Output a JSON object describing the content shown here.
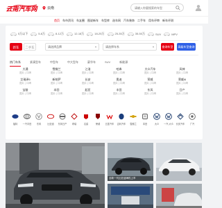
{
  "brand": {
    "logo_text": "云南汽车网",
    "accent": "#e60012"
  },
  "header": {
    "city": "云南",
    "search": {
      "placeholder": "请输入你要搜索的车型"
    }
  },
  "nav": {
    "items": [
      "首页",
      "车市资讯",
      "车友圈",
      "图说新车",
      "车型库",
      "选车网",
      "汽车装饰",
      "二手车",
      "用车评审",
      "新车评测",
      "维权平台",
      "保险评审"
    ]
  },
  "finder": {
    "price_ranges": [
      "5万以下",
      "5-8万",
      "8-12万",
      "12-18万",
      "18-25万",
      "25-35万",
      "35-50万",
      "50万以上",
      "SUV",
      "MPV",
      "跑车"
    ],
    "mode_new": "新车",
    "mode_used": "二手车",
    "brand_select": "请选择品牌",
    "series_select": "请选择车系",
    "query_button": "查询车型",
    "advanced_button": "高级车型查询"
  },
  "tabs": [
    "热门车系",
    "紧凑型车",
    "中型车",
    "中大型车",
    "豪华车",
    "SUV",
    "新能源"
  ],
  "brand_grid": [
    {
      "name": "大通",
      "subs": "图片 | 口碑"
    },
    {
      "name": "雪佛兰",
      "subs": "图片 | 口碑"
    },
    {
      "name": "江淮",
      "subs": "图片 | 口碑"
    },
    {
      "name": "哈弗",
      "subs": "图片 | 口碑"
    },
    {
      "name": "大众汽车",
      "subs": "图片 | 口碑"
    },
    {
      "name": "风神",
      "subs": "图片 | 口碑"
    },
    {
      "name": "大众",
      "subs": "图片 | 口碑"
    },
    {
      "name": "艾瑞泽5",
      "subs": "图片 | 口碑"
    },
    {
      "name": "新帕萨",
      "subs": "图片 | 口碑"
    },
    {
      "name": "长安",
      "subs": "图片 | 口碑"
    },
    {
      "name": "奥迪",
      "subs": "图片 | 口碑"
    },
    {
      "name": "荣威",
      "subs": "图片 | 口碑"
    },
    {
      "name": "荣威i6",
      "subs": "图片 | 口碑"
    },
    {
      "name": "宝骏",
      "subs": "图片 | 口碑"
    },
    {
      "name": "本田",
      "subs": "图片 | 口碑"
    },
    {
      "name": "起亚",
      "subs": "图片 | 口碑"
    },
    {
      "name": "丰田",
      "subs": "图片 | 口碑"
    },
    {
      "name": "东风",
      "subs": "图片 | 口碑"
    },
    {
      "name": "日产",
      "subs": "图片 | 口碑"
    }
  ],
  "logos": [
    "福特",
    "一汽丰田",
    "东风",
    "比亚迪",
    "东风日产",
    "奇瑞",
    "名爵",
    "荣威",
    "五菱汽车",
    "吉利汽车",
    "雪佛兰",
    "本田",
    "大众",
    "一汽-大众",
    "长安汽车",
    "广汽"
  ],
  "news": {
    "big_caption": "",
    "s1_caption": "全新一代比亚迪海豹上市",
    "s2_caption": "",
    "s3_caption": "",
    "s4_caption": ""
  }
}
